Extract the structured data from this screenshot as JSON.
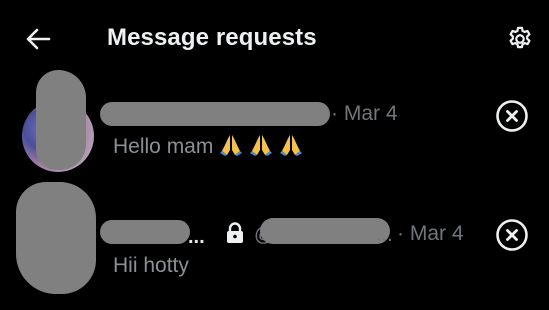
{
  "header": {
    "title": "Message requests",
    "back_icon": "back-arrow-icon",
    "settings_icon": "gear-icon"
  },
  "requests": [
    {
      "name": "",
      "date": "· Mar 4",
      "preview": "Hello mam",
      "preview_emoji": [
        "🙏",
        "🙏",
        "🙏"
      ],
      "dismiss_icon": "close-circle-icon"
    },
    {
      "name": "...",
      "protected_icon": "lock-icon",
      "handle_prefix": "@",
      "handle_suffix": "...",
      "date": "· Mar 4",
      "preview": "Hii hotty",
      "dismiss_icon": "close-circle-icon"
    }
  ],
  "colors": {
    "background": "#000000",
    "primary_text": "#e7e9ea",
    "secondary_text": "#71767b",
    "redaction": "#808080"
  }
}
